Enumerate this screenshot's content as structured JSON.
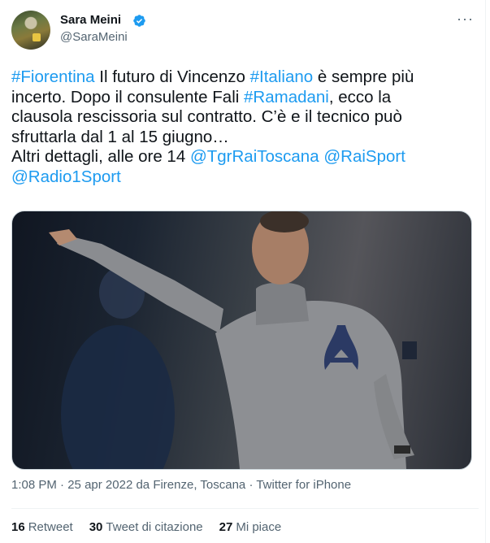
{
  "author": {
    "name": "Sara Meini",
    "handle": "@SaraMeini",
    "verified": true,
    "avatar_icon": "profile-photo",
    "more_icon": "more-options-icon"
  },
  "tweet": {
    "line1": [
      {
        "text": "#Fiorentina",
        "link": true
      },
      {
        "text": " Il futuro di Vincenzo ",
        "link": false
      },
      {
        "text": "#Italiano",
        "link": true
      },
      {
        "text": " è sempre più",
        "link": false
      }
    ],
    "line2": [
      {
        "text": "incerto. Dopo il consulente Fali ",
        "link": false
      },
      {
        "text": "#Ramadani",
        "link": true
      },
      {
        "text": ", ecco la",
        "link": false
      }
    ],
    "line3": "clausola rescissoria sul contratto. C’è e il tecnico può",
    "line4": "sfruttarla dal 1 al 15 giugno…",
    "line5": [
      {
        "text": "Altri dettagli, alle ore 14 ",
        "link": false
      },
      {
        "text": "@TgrRaiToscana",
        "link": true
      },
      {
        "text": " ",
        "link": false
      },
      {
        "text": "@RaiSport",
        "link": true
      }
    ],
    "line6": "@Radio1Sport",
    "link_color": "#1d9bf0"
  },
  "media": {
    "description_icon": "photo-coach-pointing"
  },
  "meta": {
    "time": "1:08 PM",
    "sep": " · ",
    "date": "25 apr 2022",
    "location": " da Firenze, Toscana",
    "source": "Twitter for iPhone"
  },
  "stats": {
    "retweets_count": "16",
    "retweets_label": "Retweet",
    "quotes_count": "30",
    "quotes_label": "Tweet di citazione",
    "likes_count": "27",
    "likes_label": "Mi piace"
  }
}
